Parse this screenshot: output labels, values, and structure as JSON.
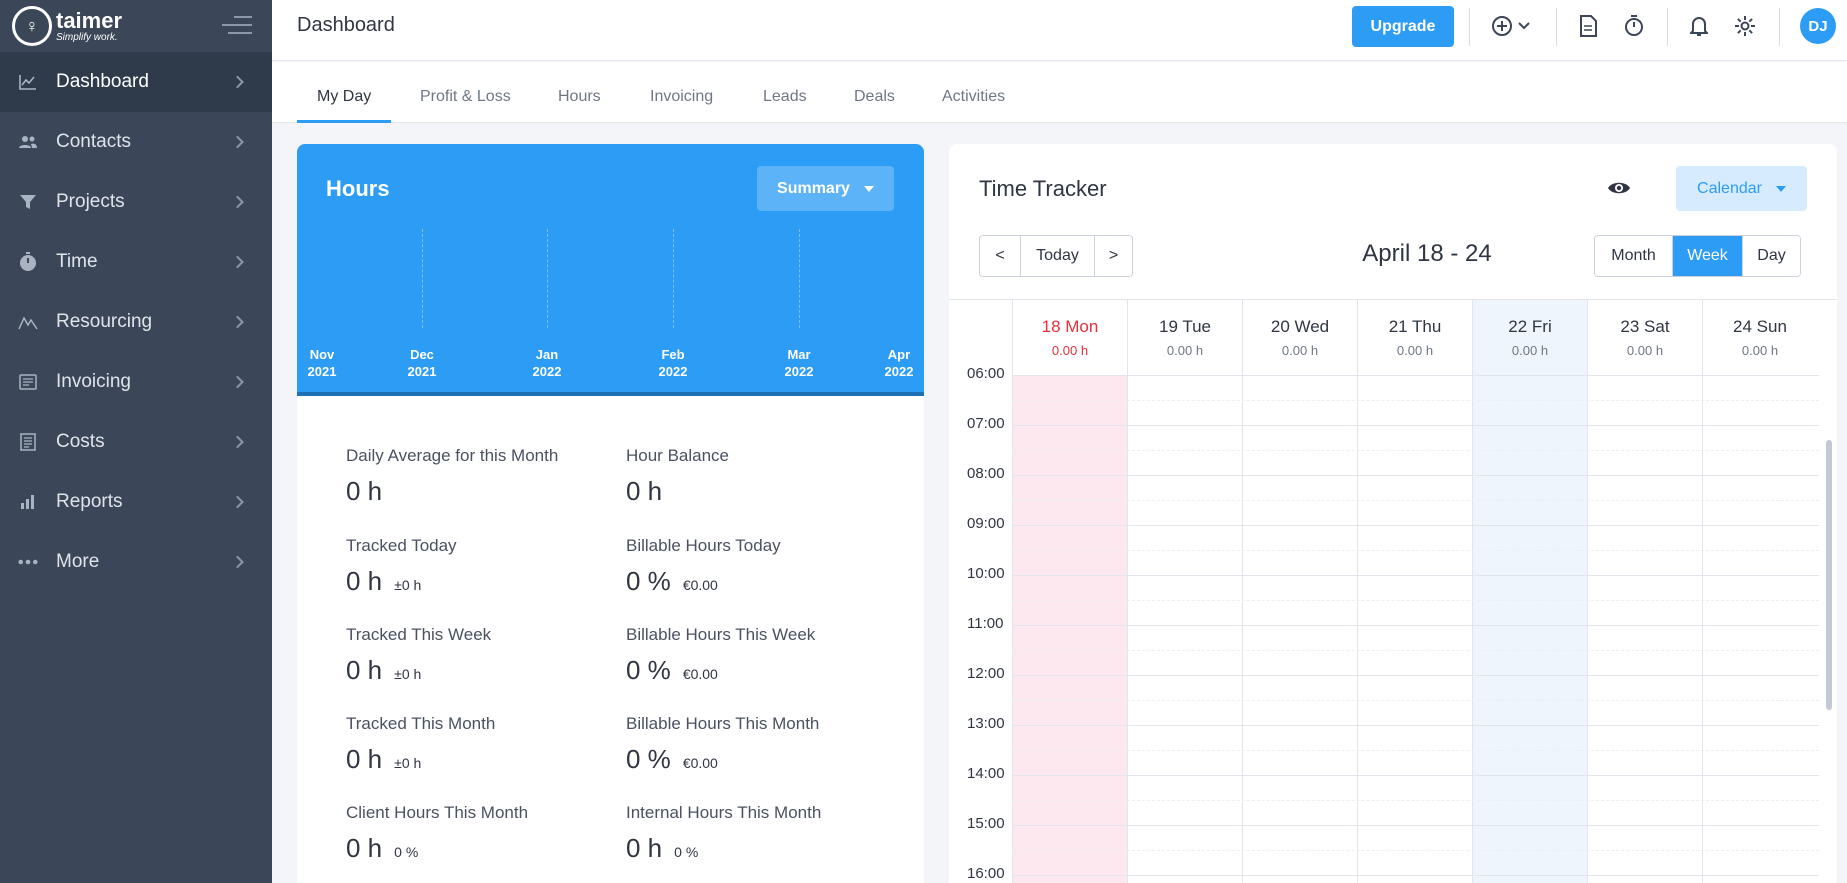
{
  "brand": {
    "name": "taimer",
    "tagline": "Simplify work."
  },
  "sidebar": {
    "items": [
      {
        "label": "Dashboard",
        "icon": "chart-icon",
        "active": true
      },
      {
        "label": "Contacts",
        "icon": "people-icon"
      },
      {
        "label": "Projects",
        "icon": "funnel-icon"
      },
      {
        "label": "Time",
        "icon": "stopwatch-icon"
      },
      {
        "label": "Resourcing",
        "icon": "resourcing-icon"
      },
      {
        "label": "Invoicing",
        "icon": "invoice-icon"
      },
      {
        "label": "Costs",
        "icon": "receipt-icon"
      },
      {
        "label": "Reports",
        "icon": "bar-chart-icon"
      },
      {
        "label": "More",
        "icon": "dots-icon"
      }
    ]
  },
  "header": {
    "title": "Dashboard",
    "upgrade_label": "Upgrade",
    "user_initials": "DJ"
  },
  "tabs": [
    "My Day",
    "Profit & Loss",
    "Hours",
    "Invoicing",
    "Leads",
    "Deals",
    "Activities"
  ],
  "hours": {
    "title": "Hours",
    "summary_label": "Summary",
    "months": [
      {
        "m": "Nov",
        "y": "2021"
      },
      {
        "m": "Dec",
        "y": "2021"
      },
      {
        "m": "Jan",
        "y": "2022"
      },
      {
        "m": "Feb",
        "y": "2022"
      },
      {
        "m": "Mar",
        "y": "2022"
      },
      {
        "m": "Apr",
        "y": "2022"
      }
    ],
    "stats": [
      {
        "label": "Daily Average for this Month",
        "value": "0 h",
        "extra": ""
      },
      {
        "label": "Hour Balance",
        "value": "0 h",
        "extra": ""
      },
      {
        "label": "Tracked Today",
        "value": "0 h",
        "extra": "±0 h"
      },
      {
        "label": "Billable Hours Today",
        "value": "0 %",
        "extra": "€0.00"
      },
      {
        "label": "Tracked This Week",
        "value": "0 h",
        "extra": "±0 h"
      },
      {
        "label": "Billable Hours This Week",
        "value": "0 %",
        "extra": "€0.00"
      },
      {
        "label": "Tracked This Month",
        "value": "0 h",
        "extra": "±0 h"
      },
      {
        "label": "Billable Hours This Month",
        "value": "0 %",
        "extra": "€0.00"
      },
      {
        "label": "Client Hours This Month",
        "value": "0 h",
        "extra": "0 %"
      },
      {
        "label": "Internal Hours This Month",
        "value": "0 h",
        "extra": "0 %"
      }
    ]
  },
  "tracker": {
    "title": "Time Tracker",
    "calendar_label": "Calendar",
    "prev_label": "<",
    "today_label": "Today",
    "next_label": ">",
    "range": "April 18 - 24",
    "views": [
      "Month",
      "Week",
      "Day"
    ],
    "active_view": "Week",
    "days": [
      {
        "name": "18 Mon",
        "hours": "0.00 h"
      },
      {
        "name": "19 Tue",
        "hours": "0.00 h"
      },
      {
        "name": "20 Wed",
        "hours": "0.00 h"
      },
      {
        "name": "21 Thu",
        "hours": "0.00 h"
      },
      {
        "name": "22 Fri",
        "hours": "0.00 h"
      },
      {
        "name": "23 Sat",
        "hours": "0.00 h"
      },
      {
        "name": "24 Sun",
        "hours": "0.00 h"
      }
    ],
    "times": [
      "06:00",
      "07:00",
      "08:00",
      "09:00",
      "10:00",
      "11:00",
      "12:00",
      "13:00",
      "14:00",
      "15:00",
      "16:00"
    ]
  }
}
